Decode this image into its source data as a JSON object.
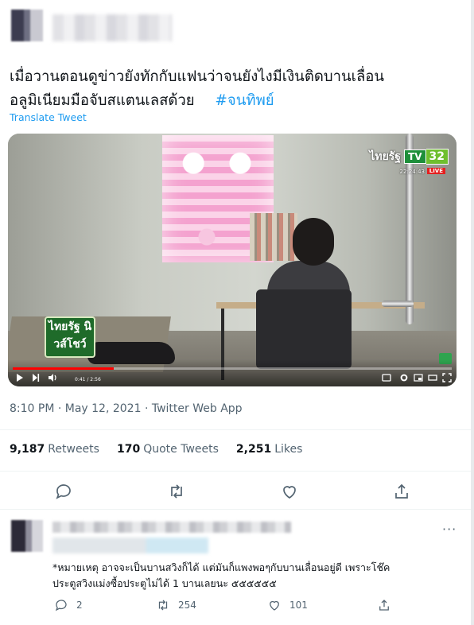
{
  "tweet": {
    "text_line1": "เมื่อวานตอนดูข่าวยังทักกับแฟนว่าจนยังไงมีเงินติดบานเลื่อน",
    "text_line2": "อลูมิเนียมมือจับสแตนเลสด้วย",
    "hashtag": "#จนทิพย์",
    "translate_label": "Translate Tweet",
    "timestamp": "8:10 PM · May 12, 2021 · Twitter Web App",
    "stats": {
      "retweets_count": "9,187",
      "retweets_label": "Retweets",
      "quote_count": "170",
      "quote_label": "Quote Tweets",
      "likes_count": "2,251",
      "likes_label": "Likes"
    }
  },
  "video": {
    "channel_name": "ไทยรัฐ",
    "channel_tv": "TV",
    "channel_number": "32",
    "clock": "22:24:43",
    "live_badge": "LIVE",
    "show_logo": "ไทยรัฐ นิวส์โชว์",
    "time_display": "0:41 / 2:56",
    "progress": 0.23
  },
  "reply": {
    "text_line1": "*หมายเหตุ อาจจะเป็นบานสวิงก็ได้ แต่มันก็แพงพอๆกับบานเลื่อนอยู่ดี เพราะโช๊ค",
    "text_line2": "ประตูสวิงแม่งซื้อประตูไม่ได้ 1 บานเลยนะ ๕๕๕๕๕๕",
    "reply_count": "2",
    "retweet_count": "254",
    "like_count": "101"
  },
  "icons": [
    "reply-icon",
    "retweet-icon",
    "like-icon",
    "share-icon",
    "more-icon",
    "play-icon",
    "next-icon",
    "volume-icon",
    "settings-icon",
    "miniplayer-icon",
    "theater-icon",
    "fullscreen-icon"
  ],
  "colors": {
    "accent": "#1d9bf0",
    "muted": "#536471",
    "progress": "#ff0000"
  }
}
